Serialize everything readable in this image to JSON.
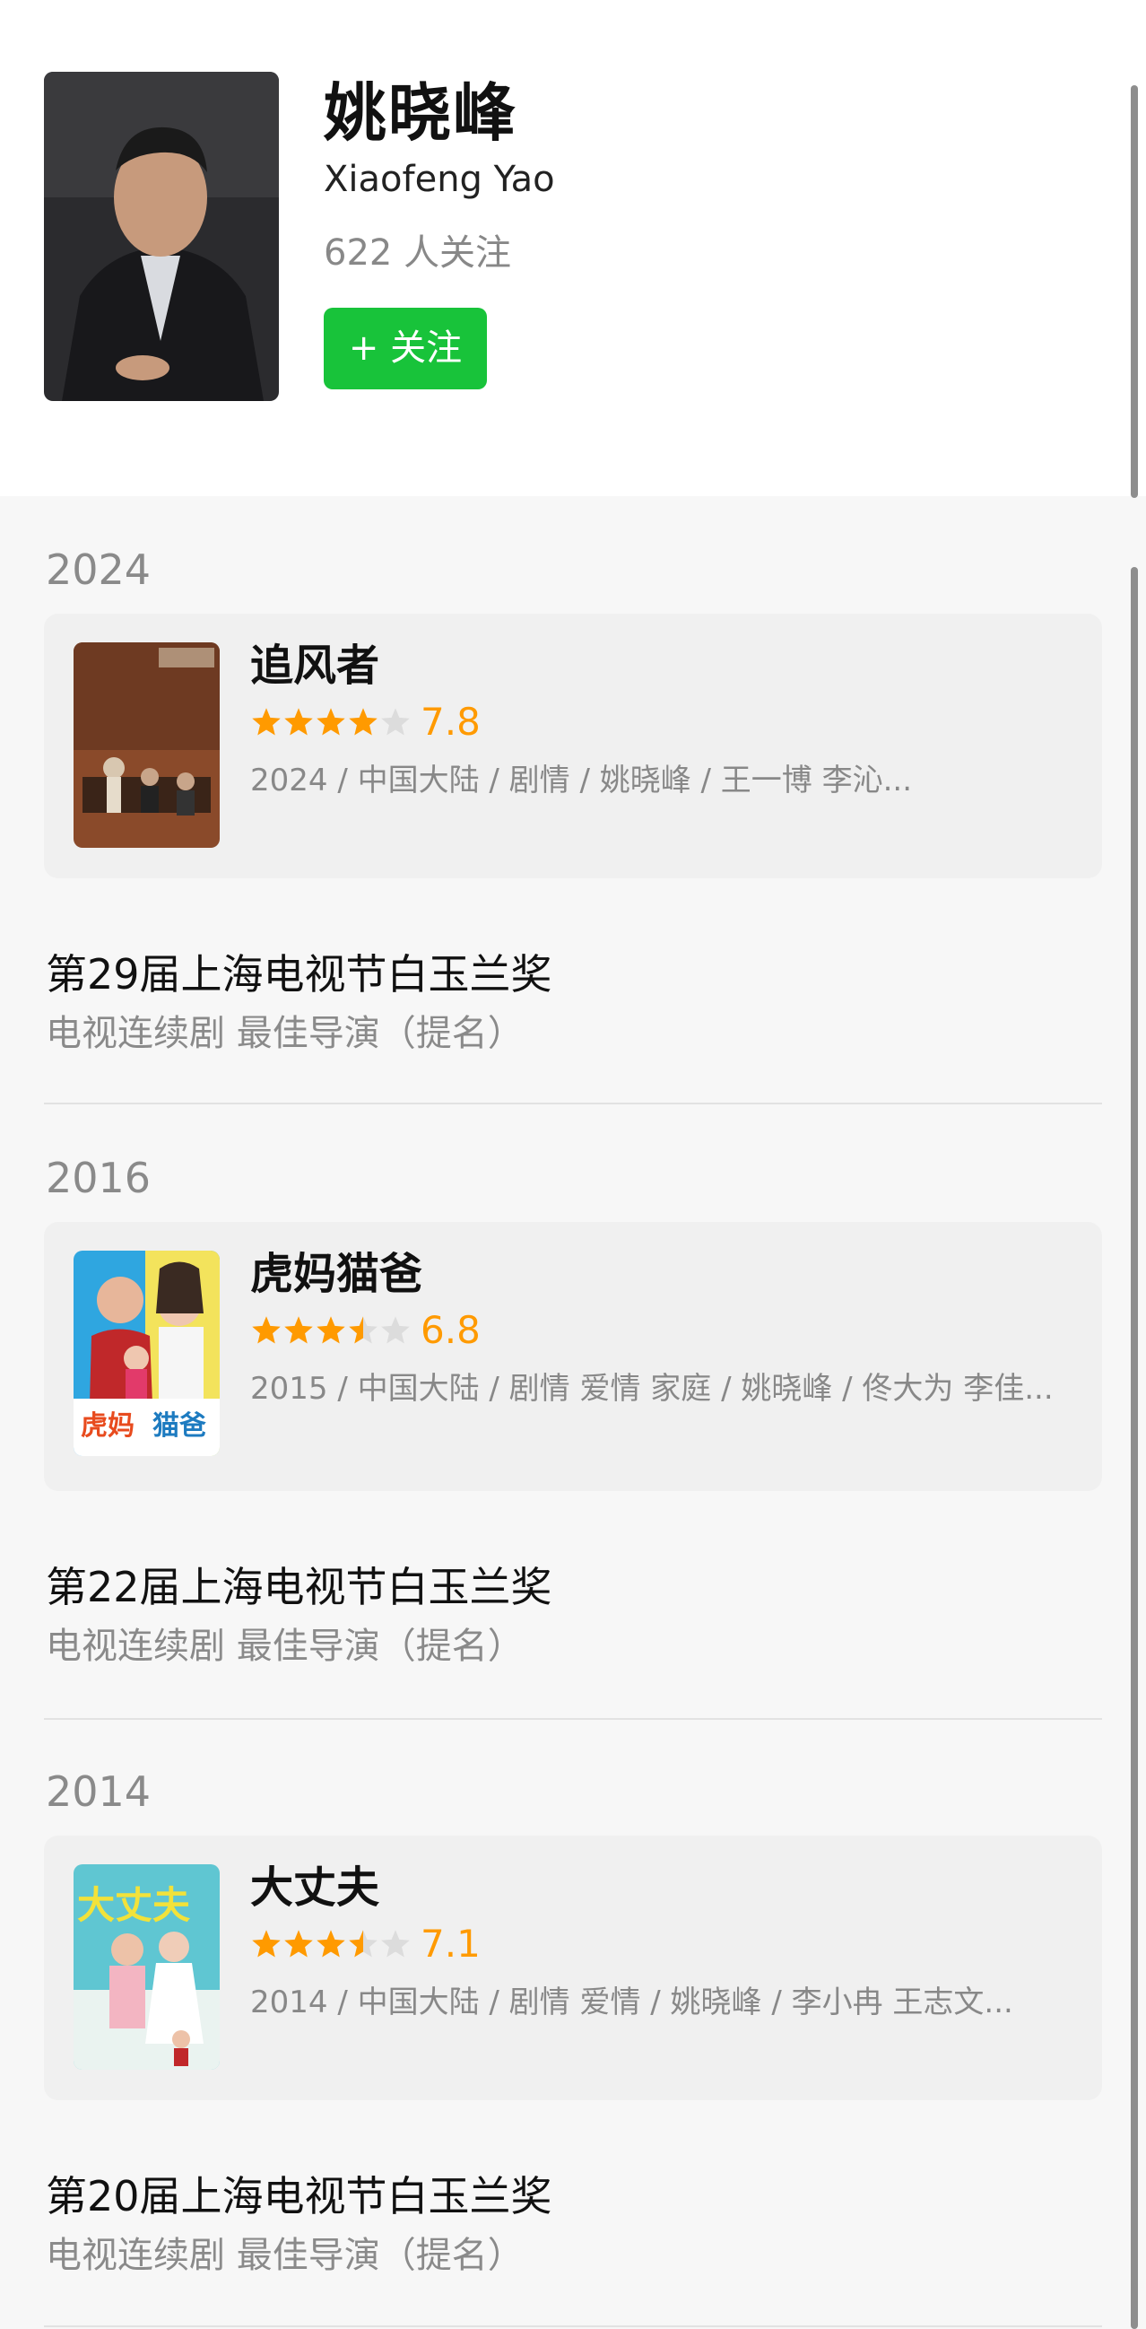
{
  "person": {
    "name_cn": "姚晓峰",
    "name_en": "Xiaofeng Yao",
    "followers": "622 人关注",
    "follow_button": "+ 关注"
  },
  "colors": {
    "follow_green": "#18c33a",
    "star_orange": "#ff9a00",
    "star_empty": "#dcdcdc"
  },
  "awards": [
    {
      "year": "2024",
      "work": {
        "title": "追风者",
        "rating": 7.8,
        "rating_text": "7.8",
        "stars": 4,
        "meta": "2024 / 中国大陆 / 剧情 / 姚晓峰 / 王一博 李沁..."
      },
      "award_name": "第29届上海电视节白玉兰奖",
      "category": "电视连续剧 最佳导演（提名）"
    },
    {
      "year": "2016",
      "work": {
        "title": "虎妈猫爸",
        "rating": 6.8,
        "rating_text": "6.8",
        "stars": 3.5,
        "meta": "2015 / 中国大陆 / 剧情 爱情 家庭 / 姚晓峰 / 佟大为 李佳..."
      },
      "award_name": "第22届上海电视节白玉兰奖",
      "category": "电视连续剧 最佳导演（提名）"
    },
    {
      "year": "2014",
      "work": {
        "title": "大丈夫",
        "rating": 7.1,
        "rating_text": "7.1",
        "stars": 3.5,
        "meta": "2014 / 中国大陆 / 剧情 爱情 / 姚晓峰 / 李小冉 王志文..."
      },
      "award_name": "第20届上海电视节白玉兰奖",
      "category": "电视连续剧 最佳导演（提名）"
    }
  ]
}
